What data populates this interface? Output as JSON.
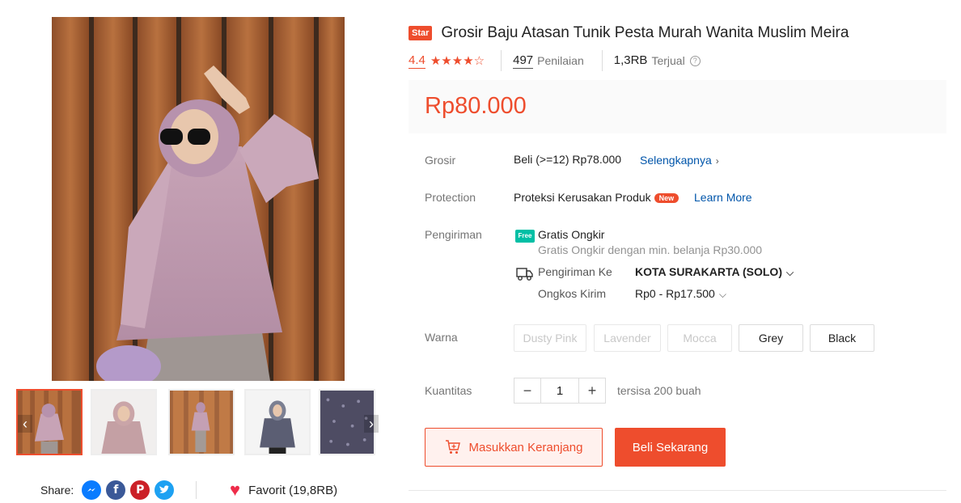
{
  "product": {
    "badge": "Star",
    "title": "Grosir Baju Atasan Tunik Pesta Murah Wanita Muslim Meira",
    "rating": "4.4",
    "rating_value": 4.4,
    "stars": "★★★★☆",
    "reviews_count": "497",
    "reviews_label": "Penilaian",
    "sold_count": "1,3RB",
    "sold_label": "Terjual",
    "price": "Rp80.000"
  },
  "details": {
    "grosir": {
      "label": "Grosir",
      "text": "Beli (>=12) Rp78.000",
      "link": "Selengkapnya"
    },
    "protection": {
      "label": "Protection",
      "text": "Proteksi Kerusakan Produk",
      "badge": "New",
      "link": "Learn More"
    },
    "shipping": {
      "label": "Pengiriman",
      "free_icon": "Free",
      "free_title": "Gratis Ongkir",
      "free_sub": "Gratis Ongkir dengan min. belanja Rp30.000",
      "to_label": "Pengiriman Ke",
      "to_value": "KOTA SURAKARTA (SOLO)",
      "cost_label": "Ongkos Kirim",
      "cost_value": "Rp0 - Rp17.500"
    },
    "color": {
      "label": "Warna",
      "options": [
        "Dusty Pink",
        "Lavender",
        "Mocca",
        "Grey",
        "Black"
      ]
    },
    "quantity": {
      "label": "Kuantitas",
      "value": "1",
      "minus": "−",
      "plus": "+",
      "stock": "tersisa 200 buah"
    }
  },
  "actions": {
    "cart": "Masukkan Keranjang",
    "buy": "Beli Sekarang"
  },
  "share": {
    "label": "Share:",
    "icons": [
      "messenger-icon",
      "facebook-icon",
      "pinterest-icon",
      "twitter-icon"
    ]
  },
  "favorite": {
    "label": "Favorit (19,8RB)"
  },
  "colors": {
    "accent": "#ee4d2d",
    "link": "#0055aa",
    "free": "#00bfa5"
  }
}
